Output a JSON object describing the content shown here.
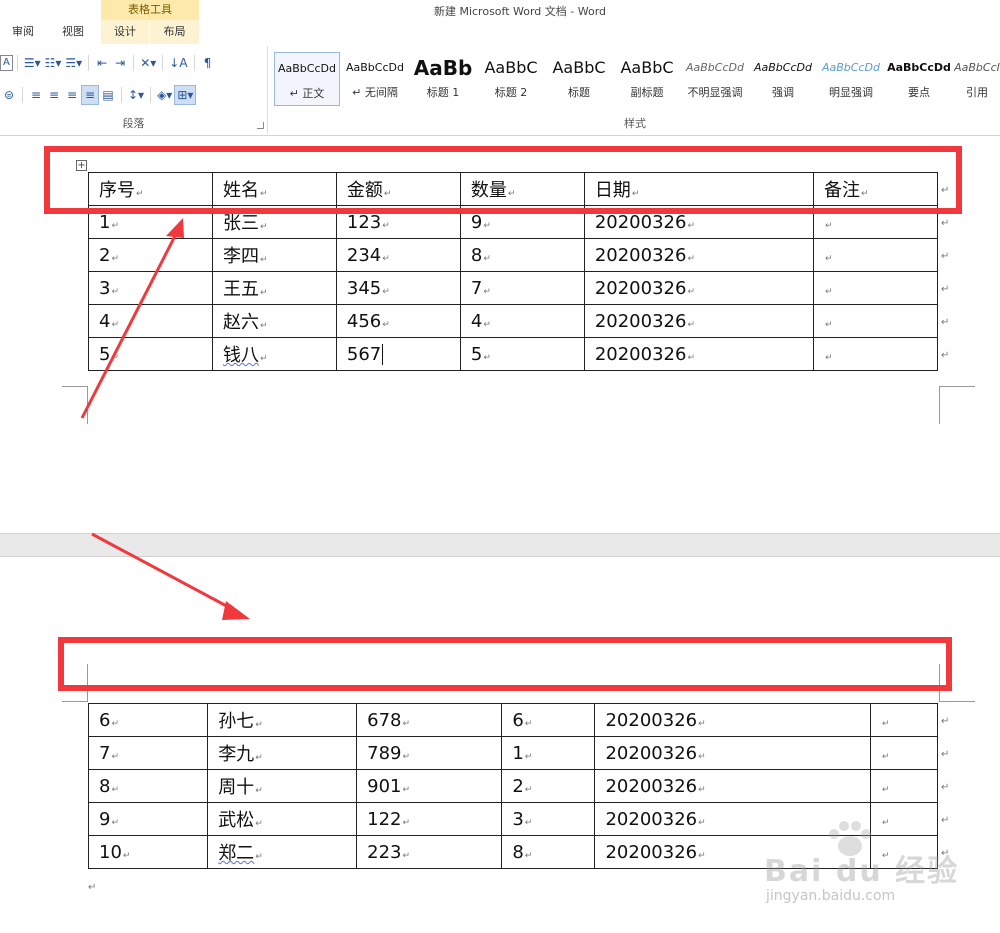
{
  "window": {
    "title": "新建 Microsoft Word 文档 - Word",
    "context_tool_title": "表格工具"
  },
  "tabs": [
    {
      "label": "审阅"
    },
    {
      "label": "视图"
    },
    {
      "label": "设计"
    },
    {
      "label": "布局"
    }
  ],
  "paragraph_group": {
    "label": "段落",
    "row1_icons": [
      "bullets-icon",
      "numbering-icon",
      "multilevel-list-icon",
      "decrease-indent-icon",
      "increase-indent-icon",
      "chinese-layout-icon",
      "sort-icon",
      "show-marks-icon"
    ],
    "row2_icons": [
      "align-left-icon",
      "align-center-icon",
      "align-right-icon",
      "justify-icon",
      "distributed-icon",
      "line-spacing-icon",
      "shading-icon",
      "borders-icon"
    ]
  },
  "styles_group": {
    "label": "样式",
    "items": [
      {
        "sample": "AaBbCcDd",
        "name": "↵ 正文",
        "selected": true
      },
      {
        "sample": "AaBbCcDd",
        "name": "↵ 无间隔"
      },
      {
        "sample": "AaBb",
        "name": "标题 1"
      },
      {
        "sample": "AaBbC",
        "name": "标题 2"
      },
      {
        "sample": "AaBbC",
        "name": "标题"
      },
      {
        "sample": "AaBbC",
        "name": "副标题"
      },
      {
        "sample": "AaBbCcDd",
        "name": "不明显强调"
      },
      {
        "sample": "AaBbCcDd",
        "name": "强调"
      },
      {
        "sample": "AaBbCcDd",
        "name": "明显强调"
      },
      {
        "sample": "AaBbCcDd",
        "name": "要点"
      },
      {
        "sample": "AaBbCcI",
        "name": "引用"
      }
    ]
  },
  "table_page1": {
    "headers": [
      "序号",
      "姓名",
      "金额",
      "数量",
      "日期",
      "备注"
    ],
    "rows": [
      [
        "1",
        "张三",
        "123",
        "9",
        "20200326",
        ""
      ],
      [
        "2",
        "李四",
        "234",
        "8",
        "20200326",
        ""
      ],
      [
        "3",
        "王五",
        "345",
        "7",
        "20200326",
        ""
      ],
      [
        "4",
        "赵六",
        "456",
        "4",
        "20200326",
        ""
      ],
      [
        "5",
        "钱八",
        "567",
        "5",
        "20200326",
        ""
      ]
    ]
  },
  "table_page2": {
    "rows": [
      [
        "6",
        "孙七",
        "678",
        "6",
        "20200326",
        ""
      ],
      [
        "7",
        "李九",
        "789",
        "1",
        "20200326",
        ""
      ],
      [
        "8",
        "周十",
        "901",
        "2",
        "20200326",
        ""
      ],
      [
        "9",
        "武松",
        "122",
        "3",
        "20200326",
        ""
      ],
      [
        "10",
        "郑二",
        "223",
        "8",
        "20200326",
        ""
      ]
    ]
  },
  "watermark": {
    "brand": "Bai du 经验",
    "url": "jingyan.baidu.com"
  },
  "colors": {
    "annotation": "#f0393d",
    "context_tab": "#fde9a9"
  }
}
